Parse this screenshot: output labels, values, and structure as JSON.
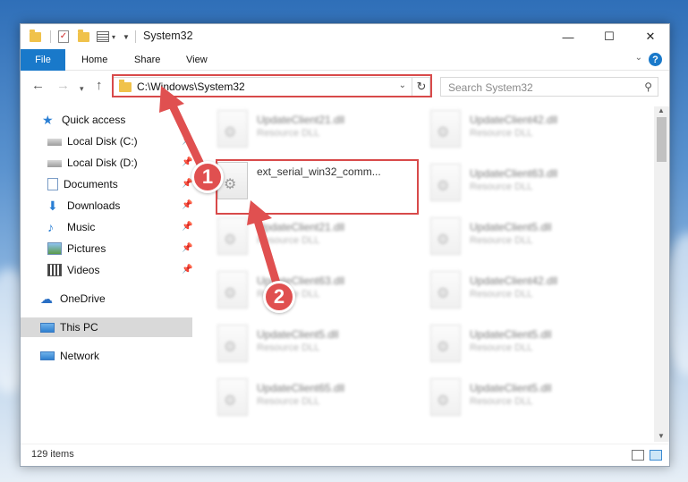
{
  "window": {
    "title": "System32"
  },
  "ribbon": {
    "tabs": [
      "File",
      "Home",
      "Share",
      "View"
    ],
    "help": "?"
  },
  "navigation": {
    "address": "C:\\Windows\\System32",
    "search_placeholder": "Search System32"
  },
  "sidebar": {
    "items": [
      {
        "label": "Quick access",
        "icon": "star-icon",
        "pinned": false
      },
      {
        "label": "Local Disk (C:)",
        "icon": "drive-icon",
        "pinned": true
      },
      {
        "label": "Local Disk (D:)",
        "icon": "drive-icon",
        "pinned": true
      },
      {
        "label": "Documents",
        "icon": "documents-icon",
        "pinned": true
      },
      {
        "label": "Downloads",
        "icon": "download-icon",
        "pinned": true
      },
      {
        "label": "Music",
        "icon": "music-icon",
        "pinned": true
      },
      {
        "label": "Pictures",
        "icon": "pictures-icon",
        "pinned": true
      },
      {
        "label": "Videos",
        "icon": "videos-icon",
        "pinned": true
      },
      {
        "label": "OneDrive",
        "icon": "cloud-icon",
        "pinned": false
      },
      {
        "label": "This PC",
        "icon": "computer-icon",
        "pinned": false
      },
      {
        "label": "Network",
        "icon": "network-icon",
        "pinned": false
      }
    ]
  },
  "files": {
    "highlighted": {
      "name": "ext_serial_win32_comm...",
      "type": ""
    },
    "items": [
      {
        "name": "UpdateClient21.dll",
        "type": "Resource DLL"
      },
      {
        "name": "UpdateClient42.dll",
        "type": "Resource DLL"
      },
      {
        "name": "UpdateClient63.dll",
        "type": "Resource DLL"
      },
      {
        "name": "UpdateClient21.dll",
        "type": "Resource DLL"
      },
      {
        "name": "UpdateClient5.dll",
        "type": "Resource DLL"
      },
      {
        "name": "UpdateClient63.dll",
        "type": "Resource DLL"
      },
      {
        "name": "UpdateClient42.dll",
        "type": "Resource DLL"
      },
      {
        "name": "UpdateClient5.dll",
        "type": "Resource DLL"
      },
      {
        "name": "UpdateClient5.dll",
        "type": "Resource DLL"
      },
      {
        "name": "UpdateClient65.dll",
        "type": "Resource DLL"
      },
      {
        "name": "UpdateClient5.dll",
        "type": "Resource DLL"
      }
    ]
  },
  "status": {
    "item_count": "129 items"
  },
  "annotations": {
    "step1": "1",
    "step2": "2",
    "color": "#e05050"
  }
}
